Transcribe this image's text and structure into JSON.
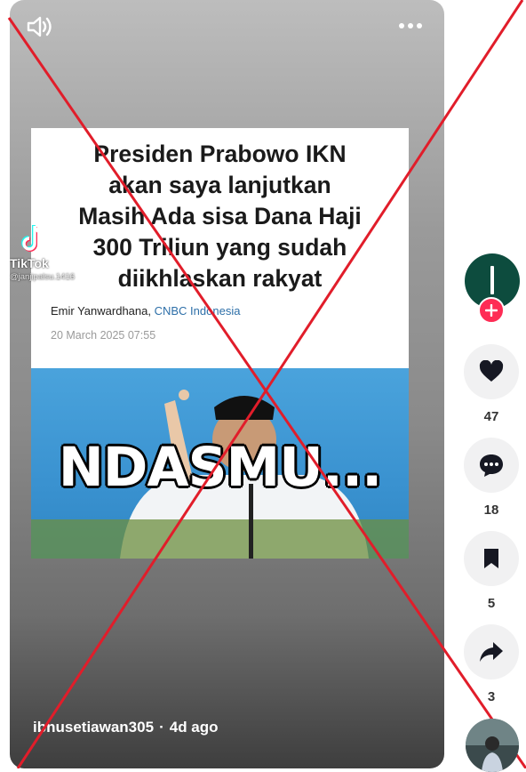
{
  "video": {
    "headline_lines": [
      "Presiden Prabowo IKN",
      "akan saya lanjutkan",
      "Masih Ada sisa Dana Haji",
      "300 Triliun yang sudah",
      "diikhlaskan rakyat"
    ],
    "byline_author": "Emir Yanwardhana,",
    "byline_source": "CNBC Indonesia",
    "date": "20 March 2025 07:55",
    "caption": "NDASMU...",
    "watermark_name": "TikTok",
    "watermark_user": "@janjipalsu.1416",
    "author": "ibnusetiawan305",
    "separator": "·",
    "posted": "4d ago"
  },
  "actions": {
    "likes": "47",
    "comments": "18",
    "saves": "5",
    "shares": "3"
  },
  "icons": {
    "volume": "volume-icon",
    "more": "more-icon",
    "like": "heart-icon",
    "comment": "comment-icon",
    "save": "bookmark-icon",
    "share": "share-icon",
    "follow": "plus-icon"
  },
  "colors": {
    "accent": "#fe2c55",
    "cross": "#e11d2a",
    "source_link": "#2d6fa8"
  }
}
